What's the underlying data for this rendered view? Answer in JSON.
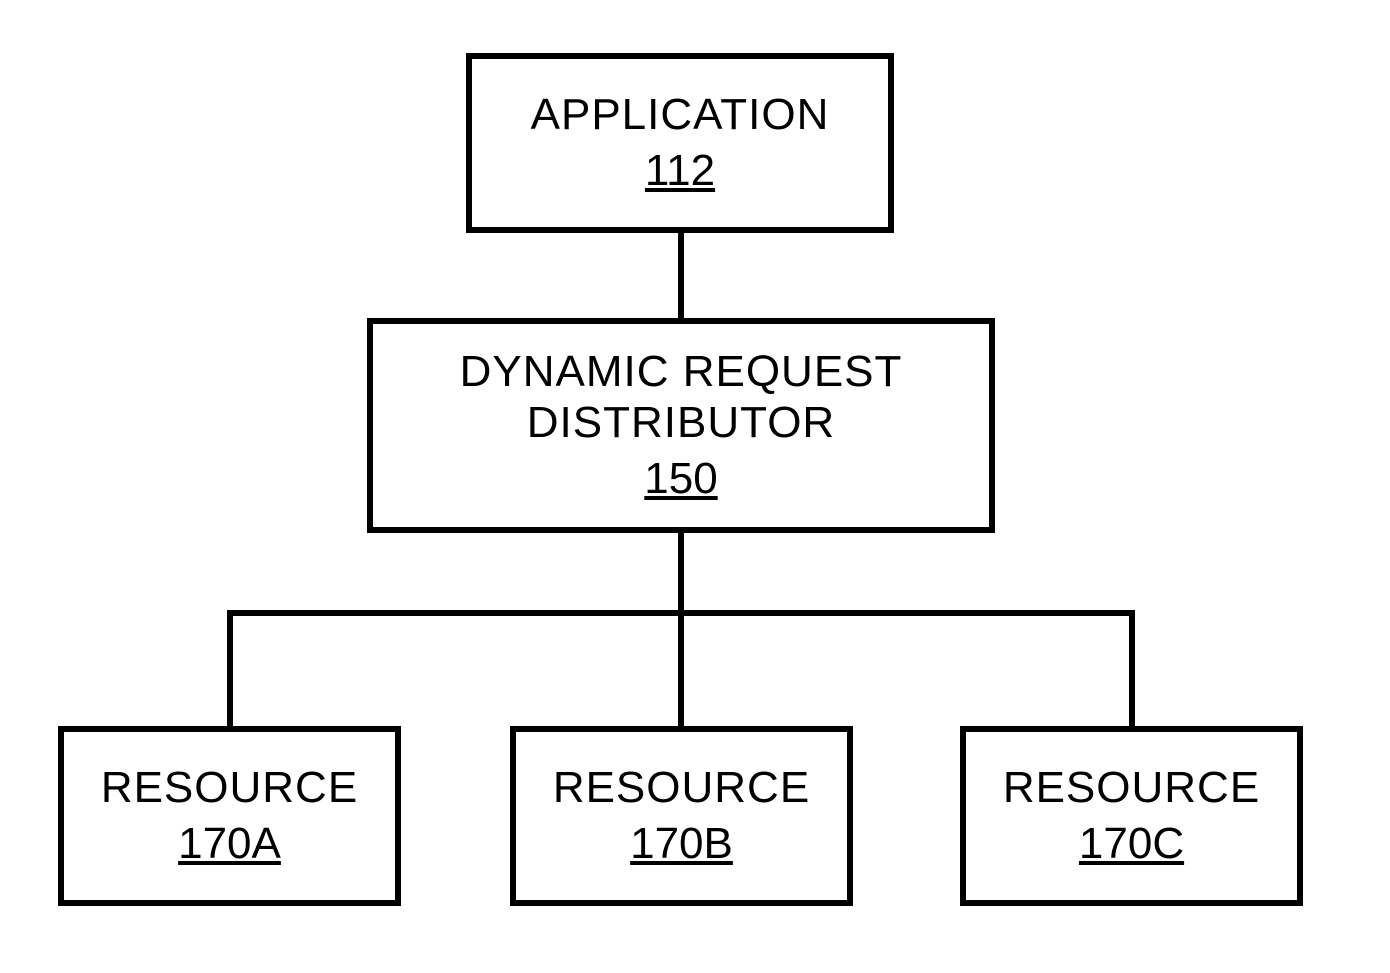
{
  "boxes": {
    "application": {
      "title": "APPLICATION",
      "num": "112"
    },
    "distributor": {
      "title": "DYNAMIC REQUEST\nDISTRIBUTOR",
      "num": "150"
    },
    "resourceA": {
      "title": "RESOURCE",
      "num": "170A"
    },
    "resourceB": {
      "title": "RESOURCE",
      "num": "170B"
    },
    "resourceC": {
      "title": "RESOURCE",
      "num": "170C"
    }
  }
}
